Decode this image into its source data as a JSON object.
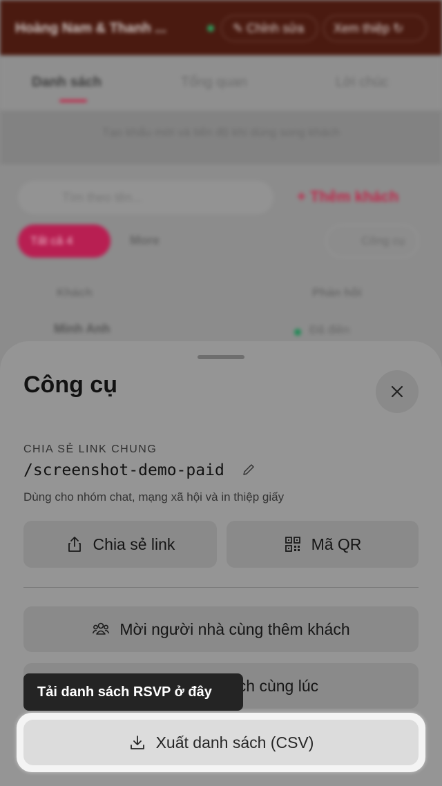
{
  "background": {
    "header": {
      "title": "Hoàng Nam & Thanh ...",
      "edit_label": "✎ Chỉnh sửa",
      "preview_label": "Xem thiệp ↻"
    },
    "tabs": [
      "Danh sách",
      "Tổng quan",
      "Lời chúc"
    ],
    "hint": "Tạo khẩu mời và tiến độ khi dùng song khách",
    "search_placeholder": "Tìm theo tên...",
    "add_guest_label": "+ Thêm khách",
    "filter_all_label": "Tất cả 4",
    "filter_more_label": "More",
    "tools_label": "Công cụ",
    "columns": [
      "Khách",
      "Phản hồi"
    ],
    "rows": [
      {
        "name": "Minh Anh",
        "status": "Đã điền"
      }
    ]
  },
  "sheet": {
    "title": "Công cụ",
    "share_section_label": "CHIA SẺ LINK CHUNG",
    "share_path": "/screenshot-demo-paid",
    "share_description": "Dùng cho nhóm chat, mạng xã hội và in thiệp giấy",
    "share_link_label": "Chia sẻ link",
    "qr_label": "Mã QR",
    "invite_family_label": "Mời người nhà cùng thêm khách",
    "bulk_add_label": "ách cùng lúc",
    "export_label": "Xuất danh sách (CSV)"
  },
  "tooltip": {
    "text": "Tải danh sách RSVP ở đây"
  },
  "colors": {
    "accent": "#c0264a",
    "overlay": "#8c8c8c",
    "tooltip_bg": "#242424"
  },
  "icons": {
    "close": "close-icon",
    "share": "share-icon",
    "qr": "qr-code-icon",
    "people": "people-icon",
    "download": "download-icon",
    "edit": "pencil-icon"
  }
}
